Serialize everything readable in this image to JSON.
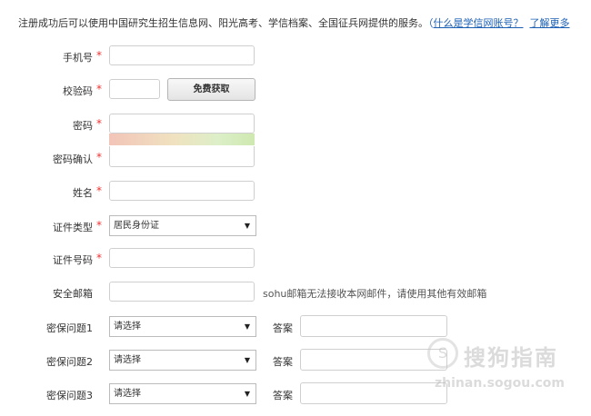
{
  "intro": {
    "text": "注册成功后可以使用中国研究生招生信息网、阳光高考、学信档案、全国征兵网提供的服务。",
    "paren_open": "（",
    "link1": "什么是学信网账号？",
    "link2": "了解更多"
  },
  "required_mark": "*",
  "fields": {
    "phone": {
      "label": "手机号",
      "value": ""
    },
    "captcha": {
      "label": "校验码",
      "value": "",
      "button": "免费获取"
    },
    "password": {
      "label": "密码",
      "value": ""
    },
    "password_confirm": {
      "label": "密码确认",
      "value": ""
    },
    "name": {
      "label": "姓名",
      "value": ""
    },
    "id_type": {
      "label": "证件类型",
      "selected": "居民身份证"
    },
    "id_number": {
      "label": "证件号码",
      "value": ""
    },
    "email": {
      "label": "安全邮箱",
      "value": "",
      "hint": "sohu邮箱无法接收本网邮件，请使用其他有效邮箱"
    }
  },
  "security_questions": [
    {
      "label": "密保问题1",
      "selected": "请选择",
      "answer_label": "答案",
      "answer": ""
    },
    {
      "label": "密保问题2",
      "selected": "请选择",
      "answer_label": "答案",
      "answer": ""
    },
    {
      "label": "密保问题3",
      "selected": "请选择",
      "answer_label": "答案",
      "answer": ""
    }
  ],
  "watermark": {
    "logo_glyph": "S",
    "name": "搜狗指南",
    "url": "zhinan.sogou.com"
  },
  "colors": {
    "link": "#1a5fb4",
    "required": "#e33333"
  }
}
